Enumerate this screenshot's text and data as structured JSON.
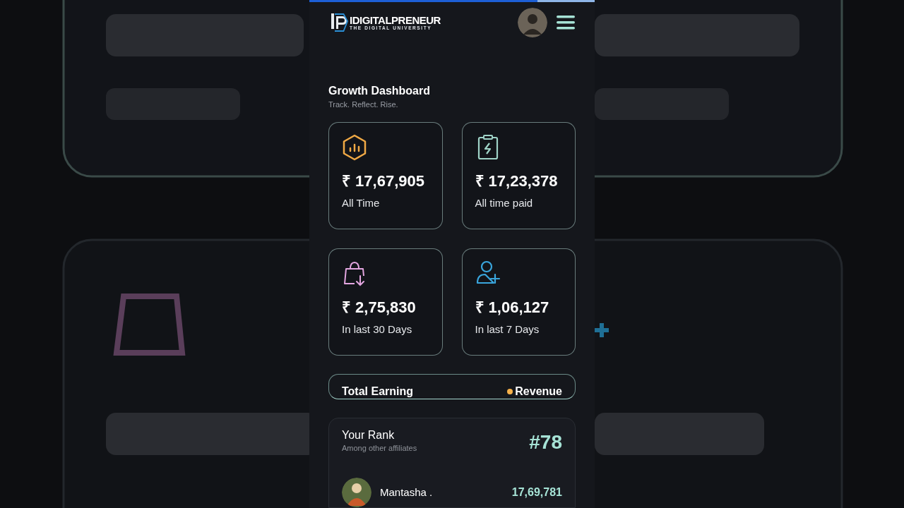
{
  "loading_bar": {
    "level": 0.8
  },
  "header": {
    "brand": "IDIGITALPRENEUR",
    "tagline": "THE DIGITAL UNIVERSITY"
  },
  "page": {
    "title": "Growth Dashboard",
    "subtitle": "Track. Reflect. Rise."
  },
  "stats": [
    {
      "kind": "chart",
      "color": "#f0a945",
      "amount": "₹ 17,67,905",
      "label": "All Time"
    },
    {
      "kind": "clipboard",
      "color": "#9fd3c7",
      "amount": "₹ 17,23,378",
      "label": "All time paid"
    },
    {
      "kind": "bag",
      "color": "#e3a6e0",
      "amount": "₹ 2,75,830",
      "label": "In last 30 Days"
    },
    {
      "kind": "user",
      "color": "#3aa6dd",
      "amount": "₹ 1,06,127",
      "label": "In last 7 Days"
    }
  ],
  "earning": {
    "title": "Total Earning",
    "legend": [
      {
        "label": "Revenue",
        "color": "#f5b04a"
      }
    ]
  },
  "rank": {
    "title": "Your Rank",
    "subtitle": "Among other affiliates",
    "value": "#78",
    "rows": [
      {
        "name": "Mantasha .",
        "value": "17,69,781"
      }
    ]
  }
}
